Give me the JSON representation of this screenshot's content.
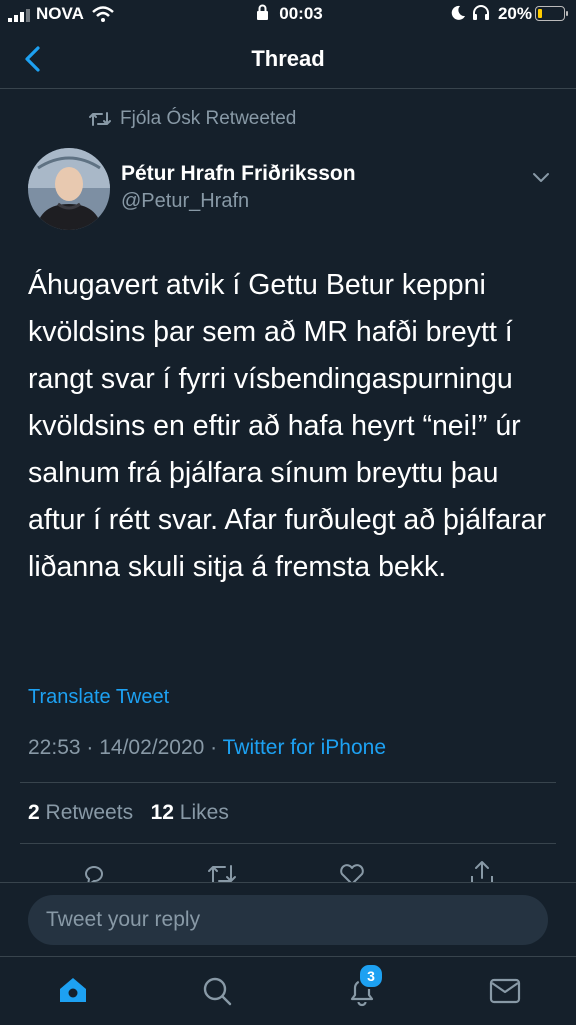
{
  "status_bar": {
    "carrier": "NOVA",
    "time": "00:03",
    "battery_percent": "20%",
    "battery_level": 0.2,
    "battery_color": "#ffcc00"
  },
  "nav": {
    "title": "Thread",
    "back_icon": "chevron-left-icon"
  },
  "tweet": {
    "retweeted_by": "Fjóla Ósk Retweeted",
    "author_name": "Pétur Hrafn Friðriksson",
    "author_handle": "@Petur_Hrafn",
    "text": "Áhugavert atvik í Gettu Betur keppni kvöldsins þar sem að MR hafði breytt í rangt svar í fyrri vísbendingaspurningu kvöldsins en eftir að hafa heyrt “nei!” úr salnum frá þjálfara sínum breyttu þau aftur í rétt svar. Afar furðulegt að þjálfarar liðanna skuli sitja á fremsta bekk.",
    "translate_label": "Translate Tweet",
    "timestamp": "22:53 · 14/02/2020 · ",
    "source": "Twitter for iPhone",
    "retweets_count": "2",
    "retweets_label": "Retweets",
    "likes_count": "12",
    "likes_label": "Likes"
  },
  "reply": {
    "placeholder": "Tweet your reply"
  },
  "tabbar": {
    "notifications_badge": "3",
    "accent": "#1da1f2"
  }
}
